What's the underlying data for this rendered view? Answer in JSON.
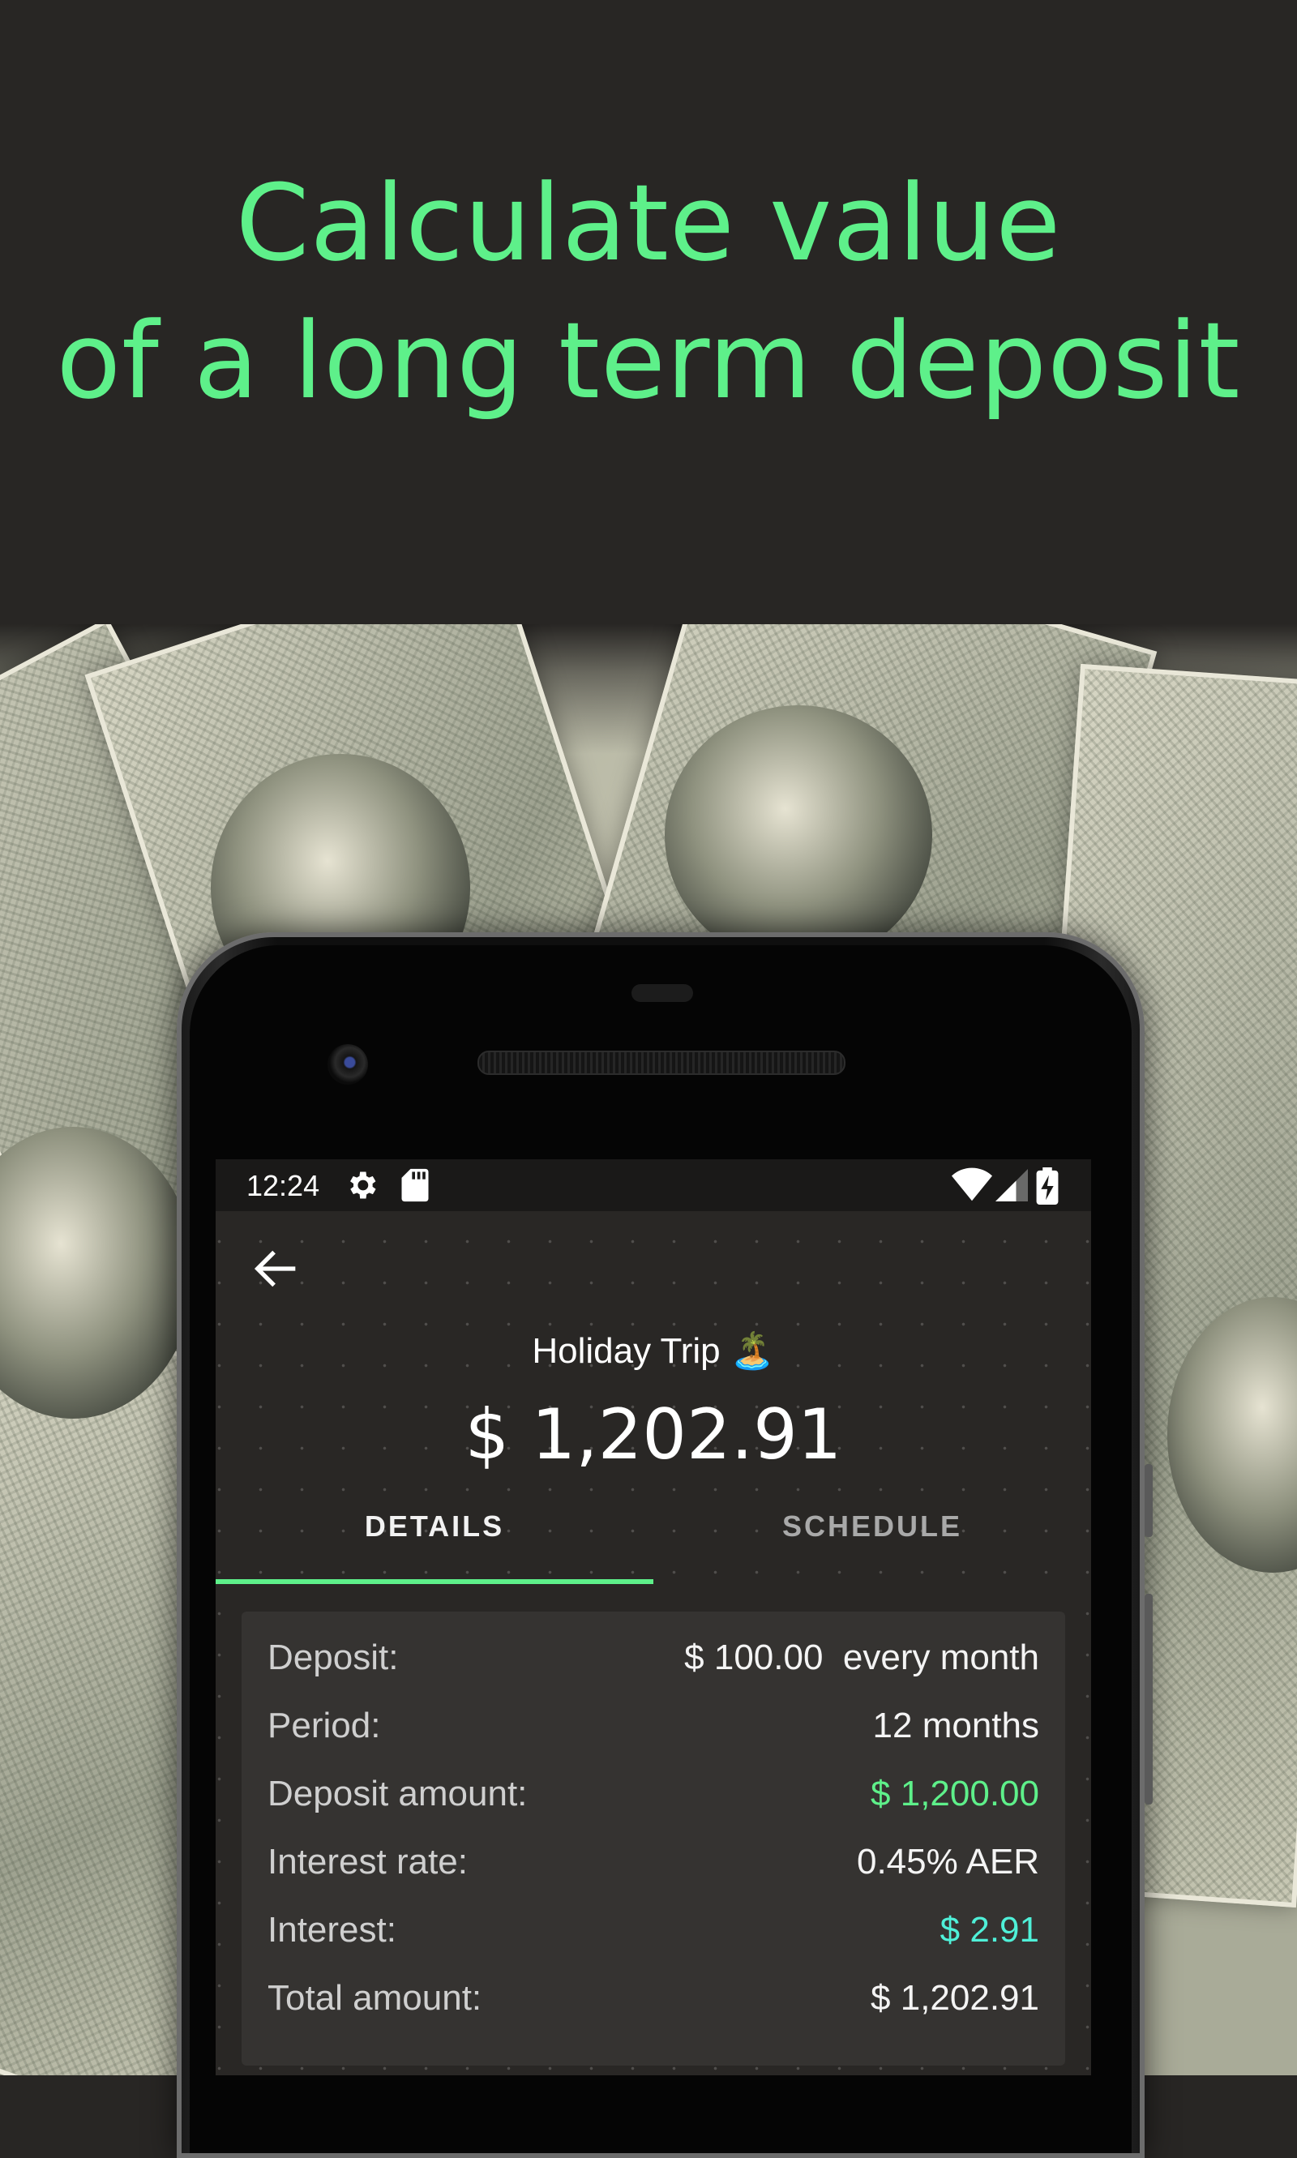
{
  "headline": {
    "line1": "Calculate value",
    "line2": "of a long term deposit",
    "color": "#5ef08a"
  },
  "status_bar": {
    "time": "12:24",
    "icons": [
      "settings-icon",
      "sd-card-icon",
      "wifi-icon",
      "cell-signal-icon",
      "battery-charging-icon"
    ]
  },
  "screen": {
    "back_icon": "arrow-left-icon",
    "title": "Holiday Trip 🏝️",
    "amount": "$ 1,202.91",
    "tabs": [
      {
        "label": "DETAILS",
        "selected": true
      },
      {
        "label": "SCHEDULE",
        "selected": false
      }
    ],
    "details": [
      {
        "label": "Deposit:",
        "value": "$ 100.00  every month",
        "color": "#f4f4f4"
      },
      {
        "label": "Period:",
        "value": "12 months",
        "color": "#f4f4f4"
      },
      {
        "label": "Deposit amount:",
        "value": "$ 1,200.00",
        "color": "#5ef08a"
      },
      {
        "label": "Interest rate:",
        "value": "0.45% AER",
        "color": "#f4f4f4"
      },
      {
        "label": "Interest:",
        "value": "$ 2.91",
        "color": "#4ff0d8"
      },
      {
        "label": "Total amount:",
        "value": "$ 1,202.91",
        "color": "#f4f4f4"
      }
    ]
  },
  "colors": {
    "accent": "#5ef08a",
    "background": "#282624",
    "screen_background": "#292725",
    "card": "#353331"
  }
}
